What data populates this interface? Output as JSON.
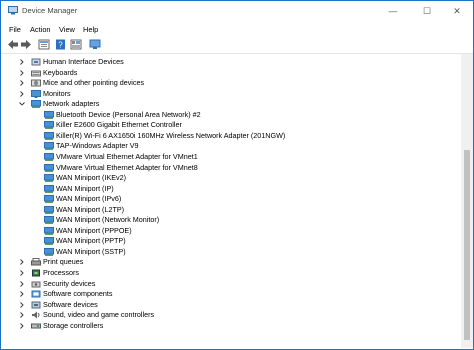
{
  "window": {
    "title": "Device Manager",
    "minimize": "—",
    "maximize": "☐",
    "close": "✕"
  },
  "menu": [
    "File",
    "Action",
    "View",
    "Help"
  ],
  "tree": [
    {
      "label": "Human Interface Devices",
      "expanded": false,
      "icon": "hid-icon"
    },
    {
      "label": "Keyboards",
      "expanded": false,
      "icon": "keyboard-icon"
    },
    {
      "label": "Mice and other pointing devices",
      "expanded": false,
      "icon": "mouse-icon"
    },
    {
      "label": "Monitors",
      "expanded": false,
      "icon": "monitor-icon"
    },
    {
      "label": "Network adapters",
      "expanded": true,
      "icon": "network-adapter-icon",
      "children": [
        "Bluetooth Device (Personal Area Network) #2",
        "Killer E2600 Gigabit Ethernet Controller",
        "Killer(R) Wi-Fi 6 AX1650i 160MHz Wireless Network Adapter (201NGW)",
        "TAP-Windows Adapter V9",
        "VMware Virtual Ethernet Adapter for VMnet1",
        "VMware Virtual Ethernet Adapter for VMnet8",
        "WAN Miniport (IKEv2)",
        "WAN Miniport (IP)",
        "WAN Miniport (IPv6)",
        "WAN Miniport (L2TP)",
        "WAN Miniport (Network Monitor)",
        "WAN Miniport (PPPOE)",
        "WAN Miniport (PPTP)",
        "WAN Miniport (SSTP)"
      ]
    },
    {
      "label": "Print queues",
      "expanded": false,
      "icon": "printer-icon"
    },
    {
      "label": "Processors",
      "expanded": false,
      "icon": "processor-icon"
    },
    {
      "label": "Security devices",
      "expanded": false,
      "icon": "security-key-icon"
    },
    {
      "label": "Software components",
      "expanded": false,
      "icon": "software-component-icon"
    },
    {
      "label": "Software devices",
      "expanded": false,
      "icon": "software-device-icon"
    },
    {
      "label": "Sound, video and game controllers",
      "expanded": false,
      "icon": "speaker-icon"
    },
    {
      "label": "Storage controllers",
      "expanded": false,
      "icon": "storage-controller-icon"
    }
  ]
}
